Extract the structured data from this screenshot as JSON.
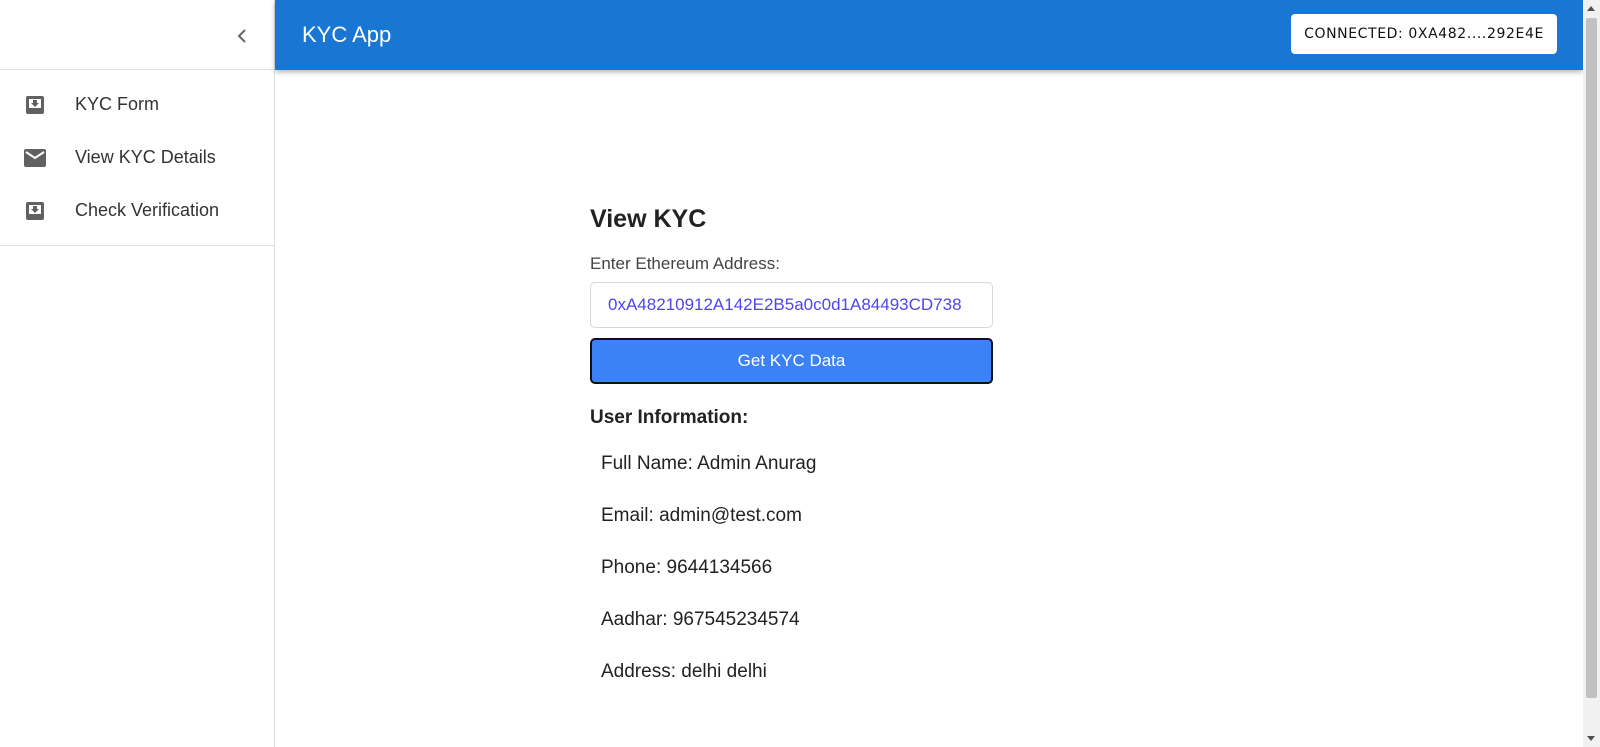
{
  "appbar": {
    "title": "KYC App",
    "connected_label": "CONNECTED: 0XA482....292E4E"
  },
  "sidebar": {
    "items": [
      {
        "label": "KYC Form",
        "icon": "move-to-inbox-icon"
      },
      {
        "label": "View KYC Details",
        "icon": "mail-icon"
      },
      {
        "label": "Check Verification",
        "icon": "move-to-inbox-icon"
      }
    ]
  },
  "main": {
    "title": "View KYC",
    "address_label": "Enter Ethereum Address:",
    "address_value": "0xA48210912A142E2B5a0c0d1A84493CD738",
    "button_label": "Get KYC Data",
    "info_heading": "User Information:",
    "info": [
      "Full Name: Admin Anurag",
      "Email: admin@test.com",
      "Phone: 9644134566",
      "Aadhar: 967545234574",
      "Address: delhi delhi"
    ]
  },
  "colors": {
    "appbar": "#1976d2",
    "button": "#3b82f6",
    "input_text": "#4f46e5"
  }
}
